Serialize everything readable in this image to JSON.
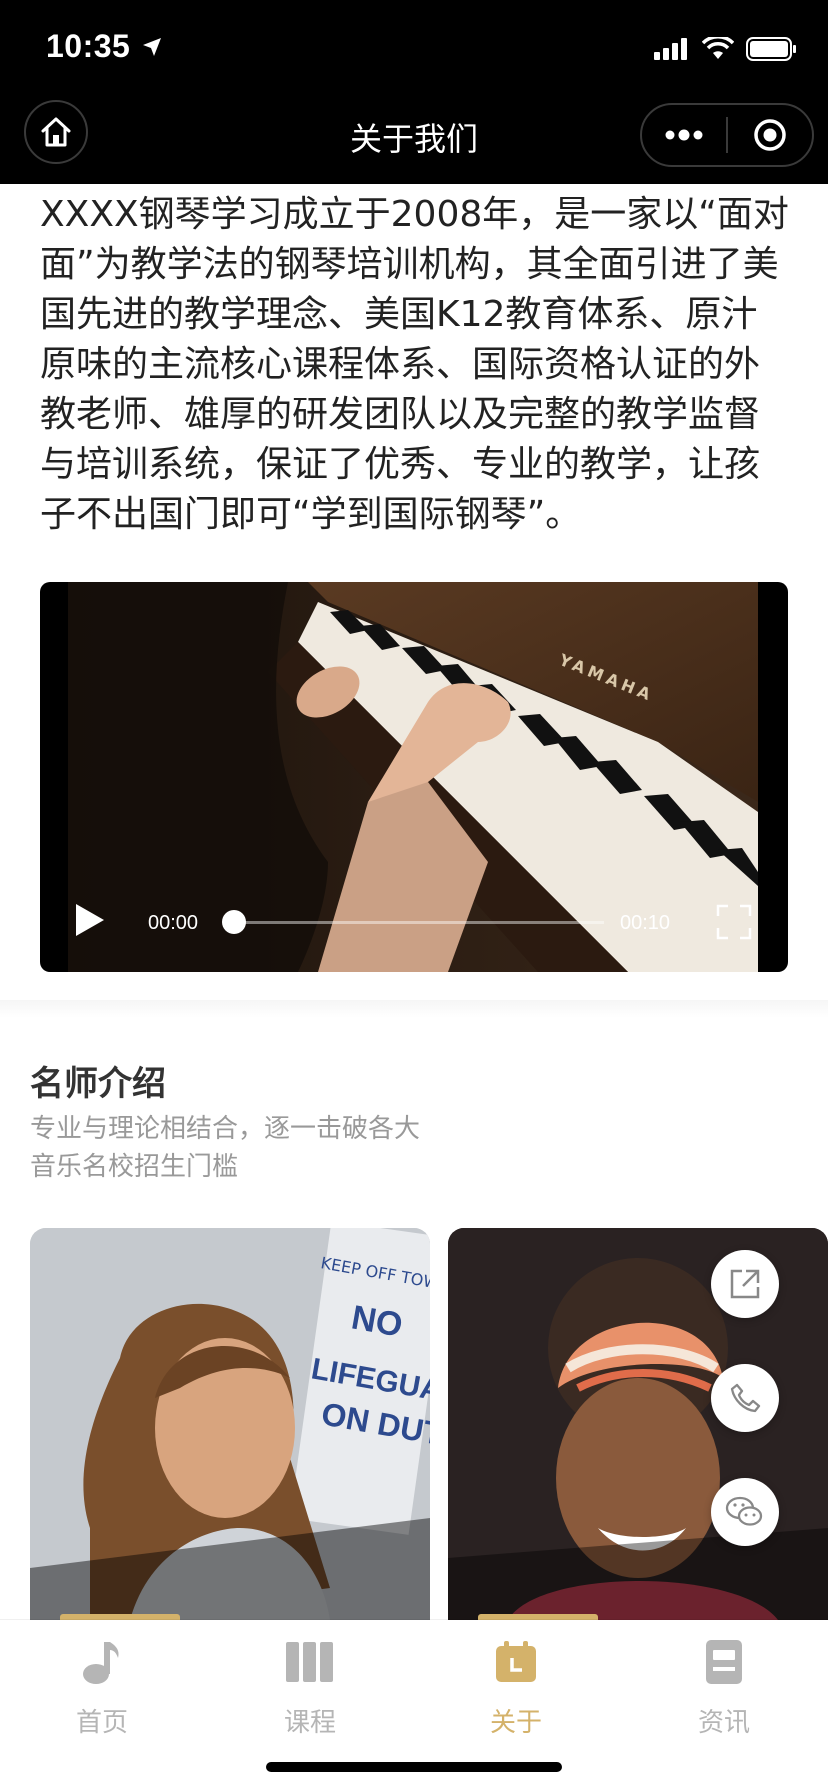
{
  "status_bar": {
    "time": "10:35"
  },
  "nav": {
    "title": "关于我们"
  },
  "intro": {
    "text": "XXXX钢琴学习成立于2008年，是一家以“面对面”为教学法的钢琴培训机构，其全面引进了美国先进的教学理念、美国K12教育体系、原汁原味的主流核心课程体系、国际资格认证的外教老师、雄厚的研发团队以及完整的教学监督与培训系统，保证了优秀、专业的教学，让孩子不出国门即可“学到国际钢琴”。"
  },
  "video": {
    "current_time": "00:00",
    "total_time": "00:10",
    "progress": 0,
    "brand_on_piano": "YAMAHA"
  },
  "teachers": {
    "title": "名师介绍",
    "subtitle_line1": "专业与理论相结合，逐一击破各大",
    "subtitle_line2": "音乐名校招生门槛",
    "card1_sign": [
      "KEEP OFF TOWER",
      "NO",
      "LIFEGUARD",
      "ON DUTY"
    ]
  },
  "fabs": [
    {
      "icon": "share-icon"
    },
    {
      "icon": "phone-icon"
    },
    {
      "icon": "wechat-icon"
    }
  ],
  "tabbar": {
    "items": [
      {
        "label": "首页",
        "icon": "music-note-icon"
      },
      {
        "label": "课程",
        "icon": "books-icon"
      },
      {
        "label": "关于",
        "icon": "calendar-icon"
      },
      {
        "label": "资讯",
        "icon": "news-icon"
      }
    ],
    "active_index": 2
  },
  "colors": {
    "accent": "#d4b26a",
    "inactive": "#b5b5b5",
    "nav_bg": "#000000"
  }
}
